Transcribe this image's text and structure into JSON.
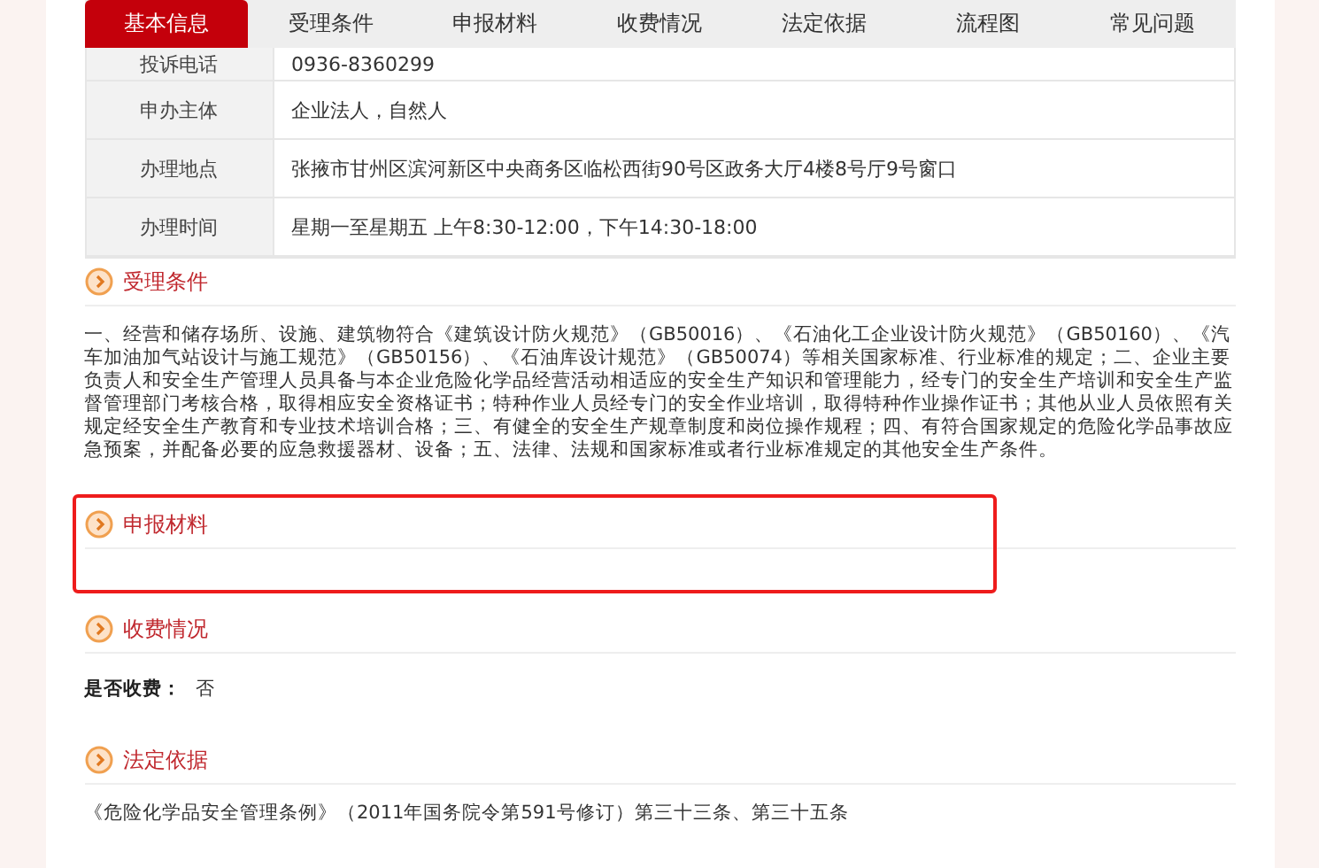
{
  "tabs": [
    {
      "label": "基本信息",
      "selected": true
    },
    {
      "label": "受理条件",
      "selected": false
    },
    {
      "label": "申报材料",
      "selected": false
    },
    {
      "label": "收费情况",
      "selected": false
    },
    {
      "label": "法定依据",
      "selected": false
    },
    {
      "label": "流程图",
      "selected": false
    },
    {
      "label": "常见问题",
      "selected": false
    }
  ],
  "info_table": {
    "rows": [
      {
        "label": "投诉电话",
        "value": "0936-8360299"
      },
      {
        "label": "申办主体",
        "value": "企业法人，自然人"
      },
      {
        "label": "办理地点",
        "value": "张掖市甘州区滨河新区中央商务区临松西街90号区政务大厅4楼8号厅9号窗口"
      },
      {
        "label": "办理时间",
        "value": "星期一至星期五 上午8:30-12:00，下午14:30-18:00"
      }
    ]
  },
  "sections": [
    {
      "title": "受理条件",
      "kind": "paragraph",
      "highlighted": false,
      "text": "一、经营和储存场所、设施、建筑物符合《建筑设计防火规范》（GB50016）、《石油化工企业设计防火规范》（GB50160）、《汽车加油加气站设计与施工规范》（GB50156）、《石油库设计规范》（GB50074）等相关国家标准、行业标准的规定；二、企业主要负责人和安全生产管理人员具备与本企业危险化学品经营活动相适应的安全生产知识和管理能力，经专门的安全生产培训和安全生产监督管理部门考核合格，取得相应安全资格证书；特种作业人员经专门的安全作业培训，取得特种作业操作证书；其他从业人员依照有关规定经安全生产教育和专业技术培训合格；三、有健全的安全生产规章制度和岗位操作规程；四、有符合国家规定的危险化学品事故应急预案，并配备必要的应急救援器材、设备；五、法律、法规和国家标准或者行业标准规定的其他安全生产条件。"
    },
    {
      "title": "申报材料",
      "kind": "empty",
      "highlighted": true
    },
    {
      "title": "收费情况",
      "kind": "field",
      "highlighted": false,
      "label": "是否收费：",
      "value": "否"
    },
    {
      "title": "法定依据",
      "kind": "paragraph",
      "highlighted": false,
      "text": "《危险化学品安全管理条例》（2011年国务院令第591号修订）第三十三条、第三十五条"
    }
  ]
}
